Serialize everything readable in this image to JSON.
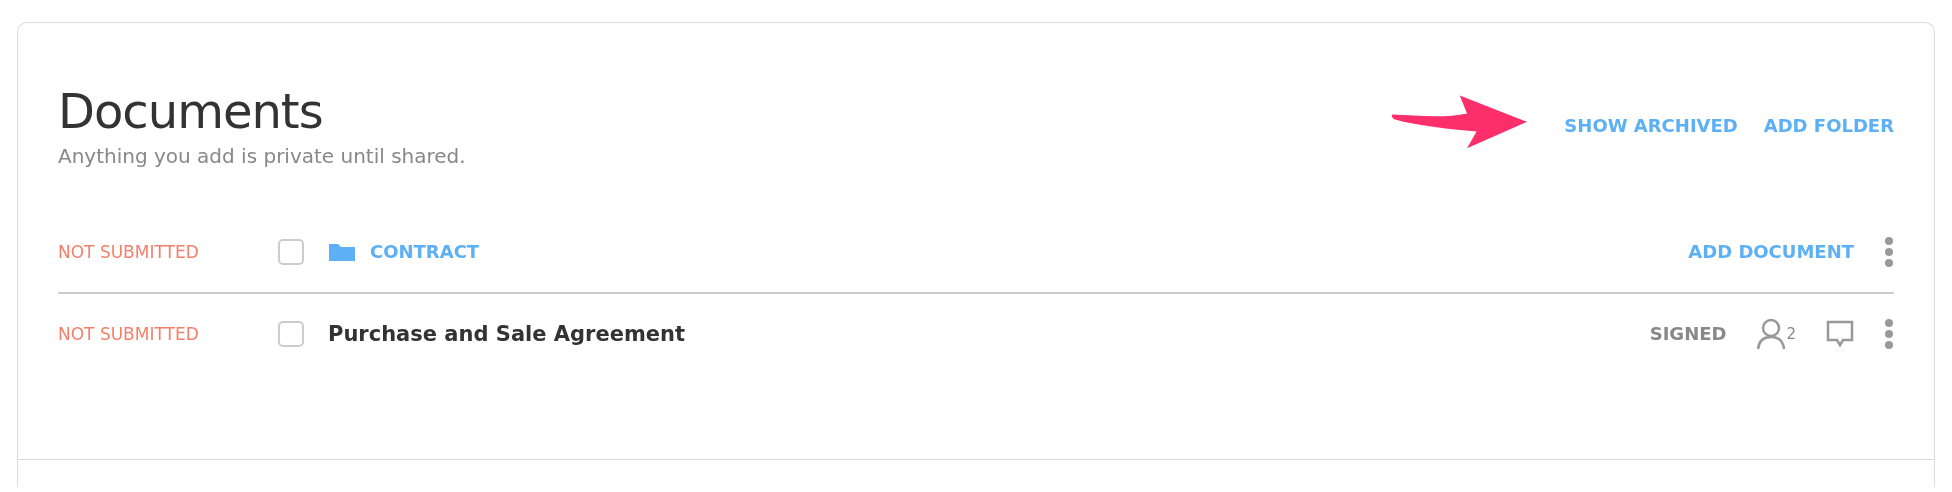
{
  "header": {
    "title": "Documents",
    "subtitle": "Anything you add is private until shared.",
    "actions": [
      "SHOW ARCHIVED",
      "ADD FOLDER"
    ]
  },
  "rows": [
    {
      "kind": "folder",
      "status": "NOT SUBMITTED",
      "checked": false,
      "name": "CONTRACT",
      "action": "ADD DOCUMENT"
    },
    {
      "kind": "document",
      "status": "NOT SUBMITTED",
      "checked": false,
      "name": "Purchase and Sale Agreement",
      "state": "SIGNED",
      "signer_count": "2"
    }
  ]
}
